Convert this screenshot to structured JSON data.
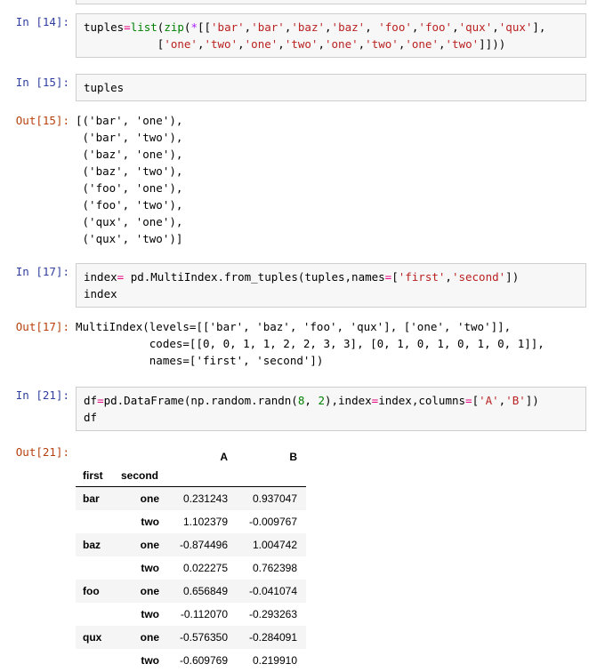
{
  "notebook": {
    "cells": [
      {
        "kind": "input",
        "prompt": "In [14]:",
        "lines": [
          [
            {
              "t": "tuples",
              "c": "plain"
            },
            {
              "t": "=",
              "c": "eq"
            },
            {
              "t": "list",
              "c": "builtin"
            },
            {
              "t": "(",
              "c": "plain"
            },
            {
              "t": "zip",
              "c": "builtin"
            },
            {
              "t": "(",
              "c": "plain"
            },
            {
              "t": "*",
              "c": "op"
            },
            {
              "t": "[[",
              "c": "plain"
            },
            {
              "t": "'bar'",
              "c": "string"
            },
            {
              "t": ",",
              "c": "plain"
            },
            {
              "t": "'bar'",
              "c": "string"
            },
            {
              "t": ",",
              "c": "plain"
            },
            {
              "t": "'baz'",
              "c": "string"
            },
            {
              "t": ",",
              "c": "plain"
            },
            {
              "t": "'baz'",
              "c": "string"
            },
            {
              "t": ", ",
              "c": "plain"
            },
            {
              "t": "'foo'",
              "c": "string"
            },
            {
              "t": ",",
              "c": "plain"
            },
            {
              "t": "'foo'",
              "c": "string"
            },
            {
              "t": ",",
              "c": "plain"
            },
            {
              "t": "'qux'",
              "c": "string"
            },
            {
              "t": ",",
              "c": "plain"
            },
            {
              "t": "'qux'",
              "c": "string"
            },
            {
              "t": "],",
              "c": "plain"
            }
          ],
          [
            {
              "t": "           [",
              "c": "plain"
            },
            {
              "t": "'one'",
              "c": "string"
            },
            {
              "t": ",",
              "c": "plain"
            },
            {
              "t": "'two'",
              "c": "string"
            },
            {
              "t": ",",
              "c": "plain"
            },
            {
              "t": "'one'",
              "c": "string"
            },
            {
              "t": ",",
              "c": "plain"
            },
            {
              "t": "'two'",
              "c": "string"
            },
            {
              "t": ",",
              "c": "plain"
            },
            {
              "t": "'one'",
              "c": "string"
            },
            {
              "t": ",",
              "c": "plain"
            },
            {
              "t": "'two'",
              "c": "string"
            },
            {
              "t": ",",
              "c": "plain"
            },
            {
              "t": "'one'",
              "c": "string"
            },
            {
              "t": ",",
              "c": "plain"
            },
            {
              "t": "'two'",
              "c": "string"
            },
            {
              "t": "]]))",
              "c": "plain"
            }
          ]
        ]
      },
      {
        "kind": "input",
        "prompt": "In [15]:",
        "lines": [
          [
            {
              "t": "tuples",
              "c": "plain"
            }
          ]
        ]
      },
      {
        "kind": "output-text",
        "prompt": "Out[15]:",
        "text": "[('bar', 'one'),\n ('bar', 'two'),\n ('baz', 'one'),\n ('baz', 'two'),\n ('foo', 'one'),\n ('foo', 'two'),\n ('qux', 'one'),\n ('qux', 'two')]"
      },
      {
        "kind": "input",
        "prompt": "In [17]:",
        "lines": [
          [
            {
              "t": "index",
              "c": "plain"
            },
            {
              "t": "=",
              "c": "eq"
            },
            {
              "t": " pd.MultiIndex.from_tuples(tuples,names",
              "c": "plain"
            },
            {
              "t": "=",
              "c": "eq"
            },
            {
              "t": "[",
              "c": "plain"
            },
            {
              "t": "'first'",
              "c": "string"
            },
            {
              "t": ",",
              "c": "plain"
            },
            {
              "t": "'second'",
              "c": "string"
            },
            {
              "t": "])",
              "c": "plain"
            }
          ],
          [
            {
              "t": "index",
              "c": "plain"
            }
          ]
        ]
      },
      {
        "kind": "output-text",
        "prompt": "Out[17]:",
        "text": "MultiIndex(levels=[['bar', 'baz', 'foo', 'qux'], ['one', 'two']],\n           codes=[[0, 0, 1, 1, 2, 2, 3, 3], [0, 1, 0, 1, 0, 1, 0, 1]],\n           names=['first', 'second'])"
      },
      {
        "kind": "input",
        "prompt": "In [21]:",
        "lines": [
          [
            {
              "t": "df",
              "c": "plain"
            },
            {
              "t": "=",
              "c": "eq"
            },
            {
              "t": "pd.DataFrame(np.random.randn(",
              "c": "plain"
            },
            {
              "t": "8",
              "c": "number"
            },
            {
              "t": ", ",
              "c": "plain"
            },
            {
              "t": "2",
              "c": "number"
            },
            {
              "t": "),index",
              "c": "plain"
            },
            {
              "t": "=",
              "c": "eq"
            },
            {
              "t": "index,columns",
              "c": "plain"
            },
            {
              "t": "=",
              "c": "eq"
            },
            {
              "t": "[",
              "c": "plain"
            },
            {
              "t": "'A'",
              "c": "string"
            },
            {
              "t": ",",
              "c": "plain"
            },
            {
              "t": "'B'",
              "c": "string"
            },
            {
              "t": "])",
              "c": "plain"
            }
          ],
          [
            {
              "t": "df",
              "c": "plain"
            }
          ]
        ]
      },
      {
        "kind": "output-table",
        "prompt": "Out[21]:"
      }
    ]
  },
  "dataframe": {
    "columns": [
      "A",
      "B"
    ],
    "index_names": [
      "first",
      "second"
    ],
    "rows": [
      {
        "first": "bar",
        "second": "one",
        "A": "0.231243",
        "B": "0.937047"
      },
      {
        "first": "",
        "second": "two",
        "A": "1.102379",
        "B": "-0.009767"
      },
      {
        "first": "baz",
        "second": "one",
        "A": "-0.874496",
        "B": "1.004742"
      },
      {
        "first": "",
        "second": "two",
        "A": "0.022275",
        "B": "0.762398"
      },
      {
        "first": "foo",
        "second": "one",
        "A": "0.656849",
        "B": "-0.041074"
      },
      {
        "first": "",
        "second": "two",
        "A": "-0.112070",
        "B": "-0.293263"
      },
      {
        "first": "qux",
        "second": "one",
        "A": "-0.576350",
        "B": "-0.284091"
      },
      {
        "first": "",
        "second": "two",
        "A": "-0.609769",
        "B": "0.219910"
      }
    ]
  },
  "theme": {
    "prompt_in_color": "#303f9f",
    "prompt_out_color": "#b7410e",
    "input_bg": "#f7f7f7",
    "input_border": "#cfcfcf",
    "string_color": "#ba2121",
    "builtin_color": "#008000",
    "operator_color": "#aa22ff",
    "equals_color": "#e5007f",
    "number_color": "#008000",
    "table_stripe": "#f5f5f5"
  }
}
